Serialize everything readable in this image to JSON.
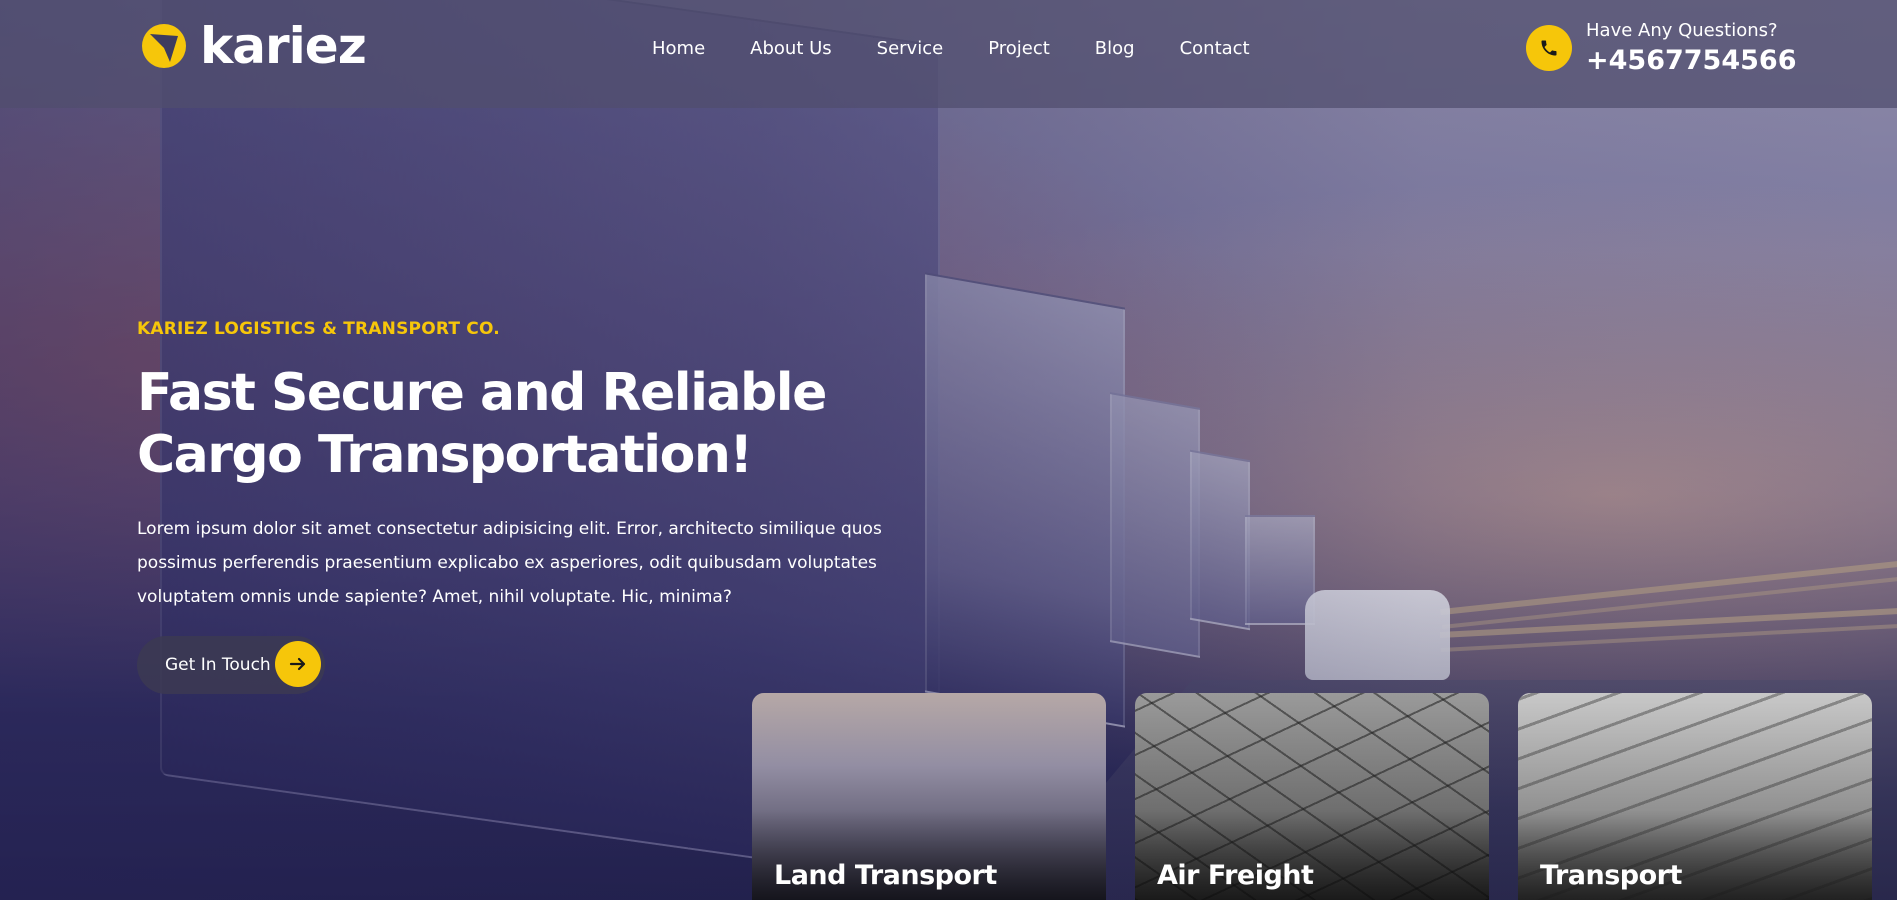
{
  "brand": {
    "name": "kariez",
    "accent_color": "#f6c60a"
  },
  "nav": {
    "items": [
      {
        "label": "Home"
      },
      {
        "label": "About Us"
      },
      {
        "label": "Service"
      },
      {
        "label": "Project"
      },
      {
        "label": "Blog"
      },
      {
        "label": "Contact"
      }
    ]
  },
  "contact": {
    "question": "Have Any Questions?",
    "phone": "+4567754566",
    "icon": "phone-icon"
  },
  "hero": {
    "eyebrow": "KARIEZ LOGISTICS & TRANSPORT CO.",
    "title": "Fast Secure and Reliable Cargo Transportation!",
    "description": "Lorem ipsum dolor sit amet consectetur adipisicing elit. Error, architecto similique quos possimus perferendis praesentium explicabo ex asperiores, odit quibusdam voluptates voluptatem omnis unde sapiente? Amet, nihil voluptate. Hic, minima?",
    "cta_label": "Get In Touch",
    "cta_icon": "arrow-right-icon"
  },
  "services": [
    {
      "title": "Land Transport"
    },
    {
      "title": "Air Freight"
    },
    {
      "title": "Transport"
    }
  ]
}
